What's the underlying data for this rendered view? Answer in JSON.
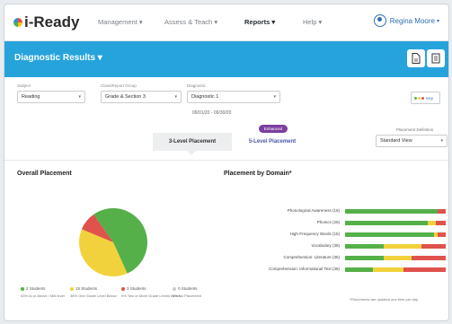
{
  "nav": {
    "logo": "i-Ready",
    "items": [
      "Management",
      "Assess & Teach",
      "Reports",
      "Help"
    ],
    "user": "Regina Moore"
  },
  "banner": {
    "title": "Diagnostic Results"
  },
  "filters": {
    "subject_label": "Subject",
    "subject": "Reading",
    "group_label": "Class/Report Group",
    "group": "Grade & Section 3",
    "diagnostic_label": "Diagnostic",
    "diagnostic": "Diagnostic 1",
    "date_range": "09/01/20 - 09/30/20",
    "key_label": "Key"
  },
  "tabs": {
    "overall": "3-Level Placement",
    "five": "5-Level Placement",
    "badge": "Enhanced",
    "pd_label": "Placement Definition",
    "pd_value": "Standard View"
  },
  "colors": {
    "green": "#55b04a",
    "yellow": "#f2d23c",
    "red": "#e0524c",
    "grey": "#c8ccd0",
    "accent": "#27a3dc"
  },
  "overall": {
    "title": "Overall Placement",
    "legend": [
      {
        "count": "2 Students",
        "pct": "53%",
        "desc": "At or Above / Mid level",
        "color": "#55b04a"
      },
      {
        "count": "15 Students",
        "pct": "38%",
        "desc": "One Grade Level Below",
        "color": "#f2d23c"
      },
      {
        "count": "3 Students",
        "pct": "9%",
        "desc": "Two or More Grade Levels Below",
        "color": "#e0524c"
      },
      {
        "count": "0 Students",
        "pct": "0%",
        "desc": "No Placement",
        "color": "#c8ccd0"
      }
    ]
  },
  "domain": {
    "title": "Placement by Domain*",
    "footnote": "*Placements are updated one time per day."
  },
  "chart_data": [
    {
      "type": "pie",
      "title": "Overall Placement",
      "categories": [
        "At or Above / Mid level",
        "One Grade Level Below",
        "Two or More Grade Levels Below",
        "No Placement"
      ],
      "values": [
        53,
        38,
        9,
        0
      ]
    },
    {
      "type": "bar",
      "orientation": "horizontal",
      "stacked": true,
      "title": "Placement by Domain*",
      "categories": [
        "Phonological Awareness (15)",
        "Phonics (25)",
        "High-Frequency Words (15)",
        "Vocabulary (35)",
        "Comprehension: Literature (35)",
        "Comprehension: Informational Text (35)"
      ],
      "series": [
        {
          "values": [
            92,
            82,
            88,
            38,
            38,
            28
          ]
        },
        {
          "values": [
            0,
            8,
            4,
            38,
            28,
            30
          ]
        },
        {
          "values": [
            8,
            10,
            8,
            24,
            34,
            42
          ]
        }
      ]
    }
  ]
}
